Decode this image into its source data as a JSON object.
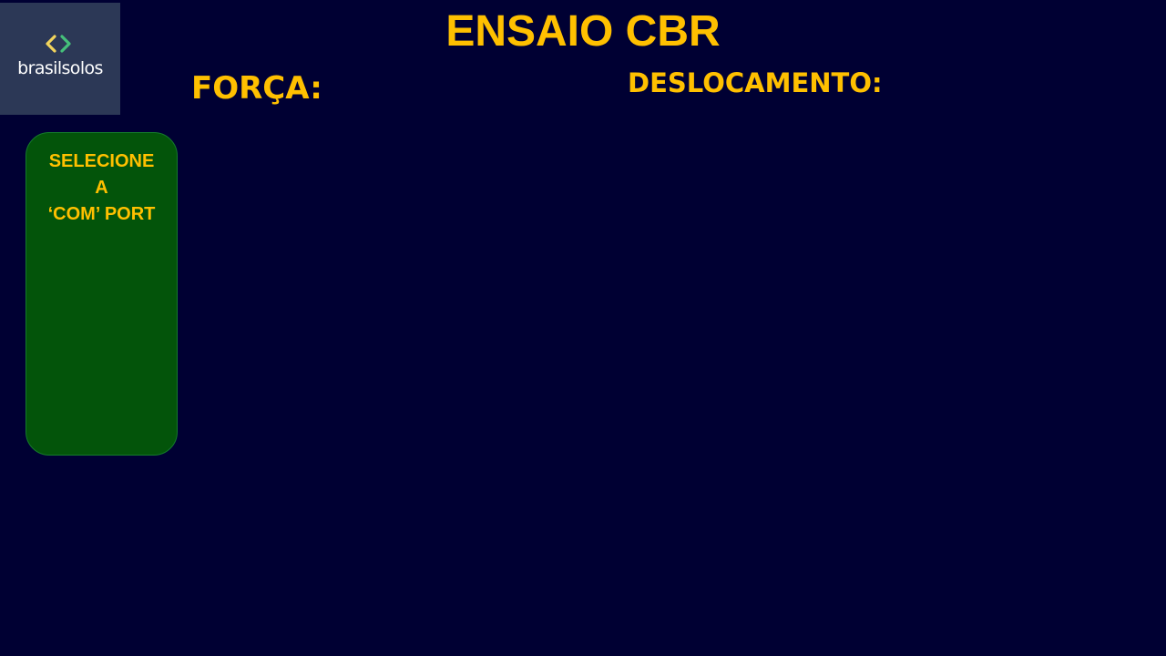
{
  "logo": {
    "text": "brasilsolos",
    "icon": "chevron-brackets-icon",
    "colors": {
      "left_chevron": "#f2d45c",
      "right_chevron": "#45c07a",
      "background": "#2c3856"
    }
  },
  "header": {
    "title": "ENSAIO CBR"
  },
  "readouts": {
    "force_label": "FORÇA:",
    "displacement_label": "DESLOCAMENTO:"
  },
  "port_selector": {
    "label": "SELECIONE A\n‘COM’ PORT"
  },
  "colors": {
    "background": "#000033",
    "accent": "#ffc000",
    "panel": "#03540a"
  }
}
